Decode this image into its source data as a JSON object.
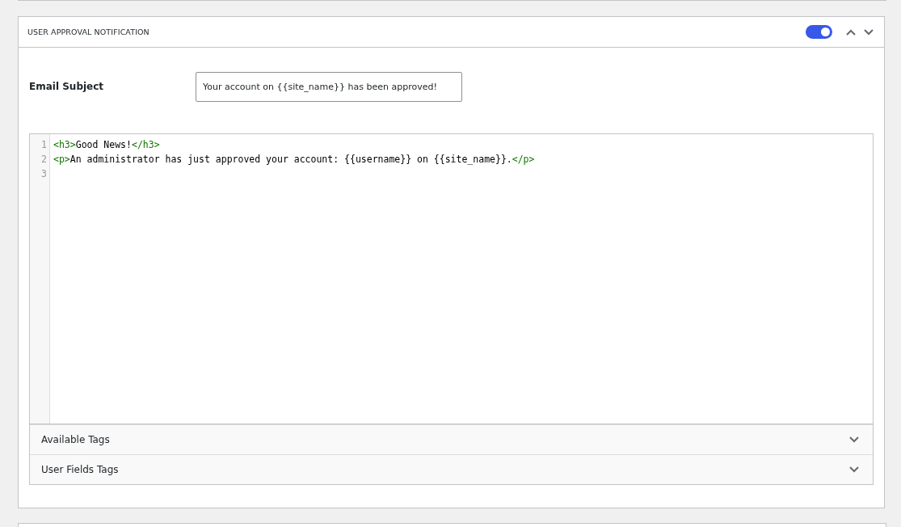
{
  "panel": {
    "title": "USER APPROVAL NOTIFICATION",
    "enabled": true
  },
  "email_subject": {
    "label": "Email Subject",
    "value": "Your account on {{site_name}} has been approved!"
  },
  "editor": {
    "lines": [
      {
        "number": "1",
        "tokens": [
          {
            "kind": "tag",
            "text": "<h3>"
          },
          {
            "kind": "text",
            "text": "Good News!"
          },
          {
            "kind": "tag",
            "text": "</h3>"
          }
        ]
      },
      {
        "number": "2",
        "tokens": [
          {
            "kind": "tag",
            "text": "<p>"
          },
          {
            "kind": "text",
            "text": "An administrator has just approved your account: {{username}} on {{site_name}}."
          },
          {
            "kind": "tag",
            "text": "</p>"
          }
        ]
      },
      {
        "number": "3"
      }
    ]
  },
  "sections": [
    {
      "label": "Available Tags",
      "expanded": false
    },
    {
      "label": "User Fields Tags",
      "expanded": false
    }
  ]
}
